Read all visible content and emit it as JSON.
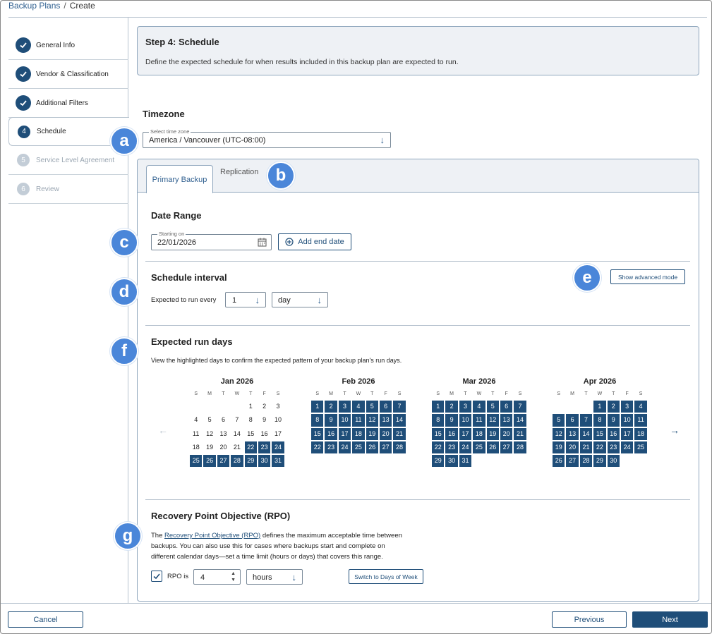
{
  "breadcrumb": {
    "parent": "Backup Plans",
    "separator": "/",
    "current": "Create"
  },
  "steps": [
    {
      "label": "General Info",
      "status": "done",
      "icon": "check-icon"
    },
    {
      "label": "Vendor & Classification",
      "status": "done",
      "icon": "check-icon"
    },
    {
      "label": "Additional Filters",
      "status": "done",
      "icon": "check-icon"
    },
    {
      "label": "Schedule",
      "status": "active",
      "number": "4"
    },
    {
      "label": "Service Level Agreement",
      "status": "disabled",
      "number": "5"
    },
    {
      "label": "Review",
      "status": "disabled",
      "number": "6"
    }
  ],
  "badges": [
    "a",
    "b",
    "c",
    "d",
    "e",
    "f",
    "g"
  ],
  "header": {
    "title": "Step 4: Schedule",
    "description": "Define the expected schedule for when results included in this backup plan are expected to run."
  },
  "timezone": {
    "title": "Timezone",
    "label": "Select time zone",
    "value": "America / Vancouver (UTC-08:00)"
  },
  "tabs": [
    {
      "label": "Primary Backup",
      "active": true
    },
    {
      "label": "Replication",
      "active": false
    }
  ],
  "date_range": {
    "title": "Date Range",
    "start_label": "Starting on",
    "start_value": "22/01/2026",
    "add_end_label": "Add end date"
  },
  "interval": {
    "title": "Schedule interval",
    "advanced_label": "Show advanced mode",
    "run_every_label": "Expected to run every",
    "count_value": "1",
    "unit_value": "day"
  },
  "run_days": {
    "title": "Expected run days",
    "description": "View the highlighted days to confirm the expected pattern of your backup plan's run days.",
    "weekday_headers": [
      "S",
      "M",
      "T",
      "W",
      "T",
      "F",
      "S"
    ],
    "months": [
      {
        "title": "Jan 2026",
        "first_weekday": 4,
        "days_in_month": 31,
        "highlight_from": 22,
        "highlight_to": 31
      },
      {
        "title": "Feb 2026",
        "first_weekday": 0,
        "days_in_month": 28,
        "highlight_from": 1,
        "highlight_to": 28
      },
      {
        "title": "Mar 2026",
        "first_weekday": 0,
        "days_in_month": 31,
        "highlight_from": 1,
        "highlight_to": 31
      },
      {
        "title": "Apr 2026",
        "first_weekday": 3,
        "days_in_month": 30,
        "highlight_from": 1,
        "highlight_to": 30
      }
    ]
  },
  "rpo": {
    "title": "Recovery Point Objective (RPO)",
    "desc_prefix": "The ",
    "desc_link": "Recovery Point Objective (RPO)",
    "desc_suffix": " defines the maximum acceptable time between",
    "desc_line2": "backups. You can also use this for cases where backups start and complete on",
    "desc_line3": "different calendar days—set a time limit (hours or days) that covers this range.",
    "checkbox_checked": true,
    "rpo_label": "RPO is",
    "value": "4",
    "unit_value": "hours",
    "switch_label": "Switch to Days of Week"
  },
  "footer": {
    "cancel": "Cancel",
    "previous": "Previous",
    "next": "Next"
  },
  "colors": {
    "primary": "#1f4e79",
    "badge": "#4a86d9",
    "panel_bg": "#eef1f5",
    "border": "#8fa6bd"
  }
}
